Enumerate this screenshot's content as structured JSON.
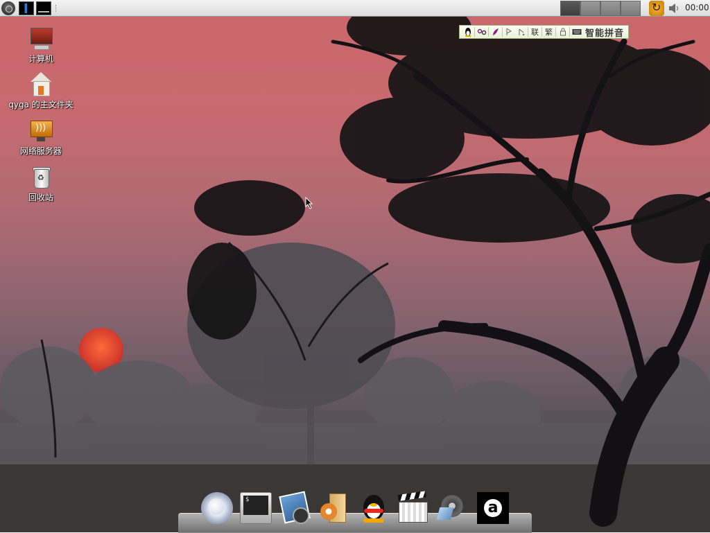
{
  "top_panel": {
    "menu_icon": "ubuntu-menu-icon",
    "applets": [
      "cpu-monitor-icon",
      "memory-monitor-icon"
    ],
    "workspaces": [
      {
        "name": "workspace-1",
        "active": true
      },
      {
        "name": "workspace-2",
        "active": false
      },
      {
        "name": "workspace-3",
        "active": false
      },
      {
        "name": "workspace-4",
        "active": false
      }
    ],
    "tray": [
      "update-manager-icon",
      "volume-icon"
    ],
    "clock": "00:00"
  },
  "ime_toolbar": {
    "icons": [
      "penguin-icon",
      "mode-icon",
      "skin-icon",
      "fullwidth-icon",
      "punctuation-icon",
      "traditional-icon",
      "lock-icon",
      "keyboard-icon"
    ],
    "lian_char": "联",
    "fan_char": "繁",
    "label": "智能拼音"
  },
  "desktop_icons": [
    {
      "name": "computer",
      "icon": "computer-icon",
      "label": "计算机"
    },
    {
      "name": "home-folder",
      "icon": "home-folder-icon",
      "label": "qyga 的主文件夹"
    },
    {
      "name": "network-servers",
      "icon": "network-server-icon",
      "label": "网络服务器"
    },
    {
      "name": "trash",
      "icon": "trash-icon",
      "label": "回收站"
    }
  ],
  "dock": {
    "items": [
      {
        "name": "firefox",
        "icon": "firefox-icon"
      },
      {
        "name": "terminal",
        "icon": "terminal-icon",
        "prompt": "$"
      },
      {
        "name": "photos",
        "icon": "photo-viewer-icon"
      },
      {
        "name": "package-installer",
        "icon": "package-icon"
      },
      {
        "name": "qq",
        "icon": "qq-penguin-icon"
      },
      {
        "name": "video-editor",
        "icon": "clapperboard-icon"
      },
      {
        "name": "media-player",
        "icon": "media-player-icon"
      },
      {
        "name": "amazon",
        "icon": "amazon-icon"
      }
    ]
  },
  "colors": {
    "sky_top": "#c9666b",
    "sun": "#e8472b",
    "panel_bg": "#dcdcdc",
    "ime_border": "#9ab27c"
  }
}
